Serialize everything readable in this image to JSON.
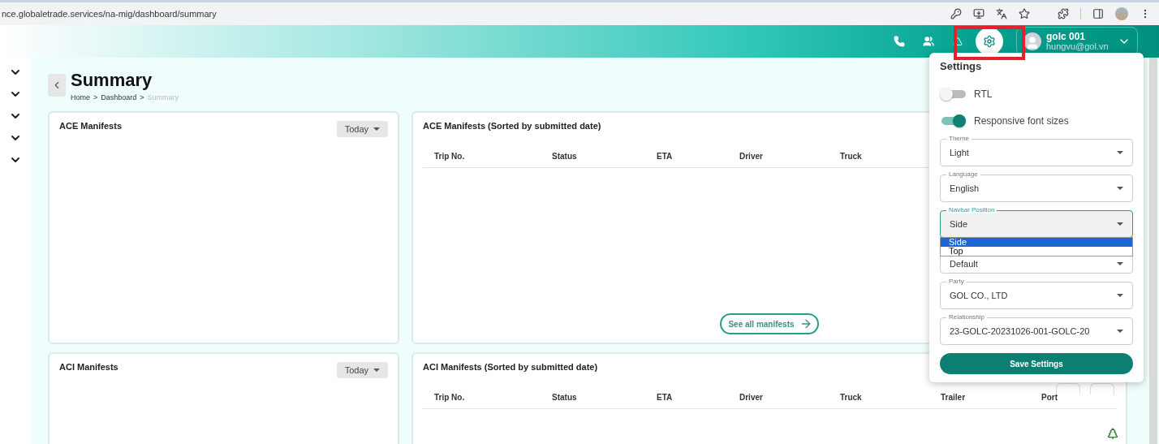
{
  "browser": {
    "url": "nce.globaletrade.services/na-mig/dashboard/summary"
  },
  "header": {
    "user": {
      "name": "golc 001",
      "email": "hungvu@gol.vn"
    }
  },
  "sidebar": {
    "items": [
      {
        "kind": "group"
      },
      {
        "kind": "group"
      },
      {
        "kind": "group"
      },
      {
        "kind": "group"
      },
      {
        "kind": "group"
      }
    ]
  },
  "page": {
    "title": "Summary",
    "separator": ">",
    "breadcrumbs": [
      {
        "label": "Home",
        "current": false
      },
      {
        "label": "Dashboard",
        "current": false
      },
      {
        "label": "Summary",
        "current": true
      }
    ]
  },
  "cards": [
    {
      "kind": "summary",
      "title": "ACE Manifests",
      "filter": "Today"
    },
    {
      "kind": "table",
      "title": "ACE Manifests (Sorted by submitted date)",
      "columns": [
        "Trip No.",
        "Status",
        "ETA",
        "Driver",
        "Truck"
      ],
      "link": "See all manifests"
    },
    {
      "kind": "summary",
      "title": "ACI Manifests",
      "filter": "Today"
    },
    {
      "kind": "table",
      "title": "ACI Manifests (Sorted by submitted date)",
      "columns": [
        "Trip No.",
        "Status",
        "ETA",
        "Driver",
        "Truck",
        "Trailer",
        "Port"
      ]
    }
  ],
  "settings": {
    "title": "Settings",
    "switches": [
      {
        "label": "RTL",
        "on": false
      },
      {
        "label": "Responsive font sizes",
        "on": true
      }
    ],
    "selects": [
      {
        "label": "Theme",
        "value": "Light",
        "focused": false
      },
      {
        "label": "Language",
        "value": "English",
        "focused": false
      },
      {
        "label": "Navbar Position",
        "value": "Side",
        "focused": true,
        "options": [
          {
            "label": "Side",
            "selected": true
          },
          {
            "label": "Top",
            "selected": false
          }
        ]
      },
      {
        "value": "Default",
        "focused": false
      },
      {
        "label": "Party",
        "value": "GOL CO., LTD",
        "focused": false
      },
      {
        "label": "Relationship",
        "value": "23-GOLC-20231026-001-GOLC-20",
        "focused": false
      }
    ],
    "button": "Save Settings"
  }
}
